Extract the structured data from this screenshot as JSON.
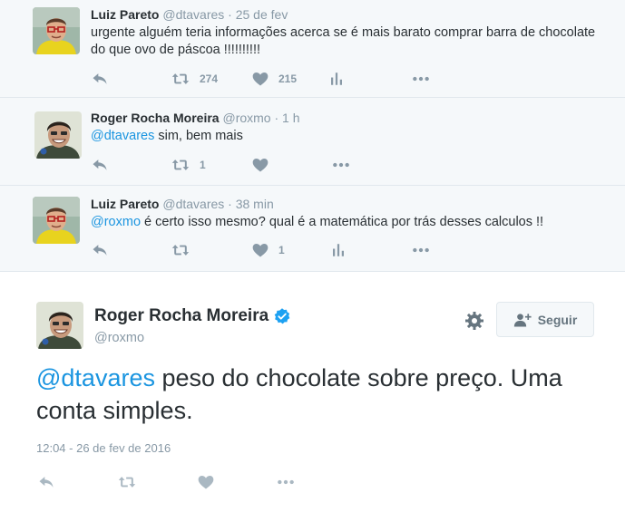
{
  "colors": {
    "mention": "#1b95e0",
    "muted": "#8899a6",
    "text": "#292f33",
    "verified": "#1da1f2",
    "reply_bg": "#f5f8fa"
  },
  "replies": [
    {
      "fullname": "Luiz Pareto",
      "handle": "@dtavares",
      "time": "· 25 de fev",
      "mention": "",
      "text": "urgente alguém teria informações acerca se é mais barato comprar barra de chocolate do que ovo de páscoa !!!!!!!!!!",
      "retweets": "274",
      "likes": "215",
      "icons": [
        "reply-icon",
        "retweet-icon",
        "heart-icon",
        "analytics-icon",
        "more-icon"
      ]
    },
    {
      "fullname": "Roger Rocha Moreira",
      "handle": "@roxmo",
      "time": "· 1 h",
      "mention": "@dtavares",
      "text": " sim, bem mais",
      "retweets": "1",
      "likes": "",
      "icons": [
        "reply-icon",
        "retweet-icon",
        "heart-icon",
        "more-icon"
      ]
    },
    {
      "fullname": "Luiz Pareto",
      "handle": "@dtavares",
      "time": "· 38 min",
      "mention": "@roxmo",
      "text": " é certo isso mesmo? qual é a matemática por trás desses calculos !!",
      "retweets": "",
      "likes": "1",
      "icons": [
        "reply-icon",
        "retweet-icon",
        "heart-icon",
        "analytics-icon",
        "more-icon"
      ]
    }
  ],
  "main_tweet": {
    "fullname": "Roger Rocha Moreira",
    "handle": "@roxmo",
    "mention": "@dtavares",
    "text": " peso do chocolate sobre preço. Uma conta simples.",
    "timestamp": "12:04 - 26 de fev de 2016",
    "follow_label": "Seguir",
    "icons": [
      "reply-icon",
      "retweet-icon",
      "heart-icon",
      "more-icon"
    ]
  }
}
